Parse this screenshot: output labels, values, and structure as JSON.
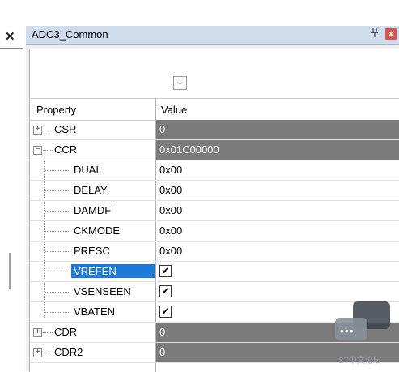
{
  "left_panel": {
    "close_glyph": "✕"
  },
  "panel": {
    "title": "ADC3_Common",
    "pin_glyph": "ᵖ",
    "close_glyph": "x",
    "dropdown_glyph": "⌵"
  },
  "grid": {
    "header": {
      "property": "Property",
      "value": "Value"
    },
    "rows": [
      {
        "name": "CSR",
        "value": "0",
        "level": 0,
        "expander": "+",
        "gray": true
      },
      {
        "name": "CCR",
        "value": "0x01C00000",
        "level": 0,
        "expander": "−",
        "gray": true
      },
      {
        "name": "DUAL",
        "value": "0x00",
        "level": 1
      },
      {
        "name": "DELAY",
        "value": "0x00",
        "level": 1
      },
      {
        "name": "DAMDF",
        "value": "0x00",
        "level": 1
      },
      {
        "name": "CKMODE",
        "value": "0x00",
        "level": 1
      },
      {
        "name": "PRESC",
        "value": "0x00",
        "level": 1
      },
      {
        "name": "VREFEN",
        "checked": true,
        "level": 1,
        "selected": true
      },
      {
        "name": "VSENSEEN",
        "checked": true,
        "level": 1
      },
      {
        "name": "VBATEN",
        "checked": true,
        "level": 1
      },
      {
        "name": "CDR",
        "value": "0",
        "level": 0,
        "expander": "+",
        "gray": true
      },
      {
        "name": "CDR2",
        "value": "0",
        "level": 0,
        "expander": "+",
        "gray": true
      }
    ]
  },
  "watermark": {
    "text": "ST中文论坛",
    "dots": "•••"
  },
  "colors": {
    "selected": "#1e78d7",
    "gray_value": "#7b7b7b",
    "titlebar": "#cfdcec",
    "close": "#d9534f"
  }
}
